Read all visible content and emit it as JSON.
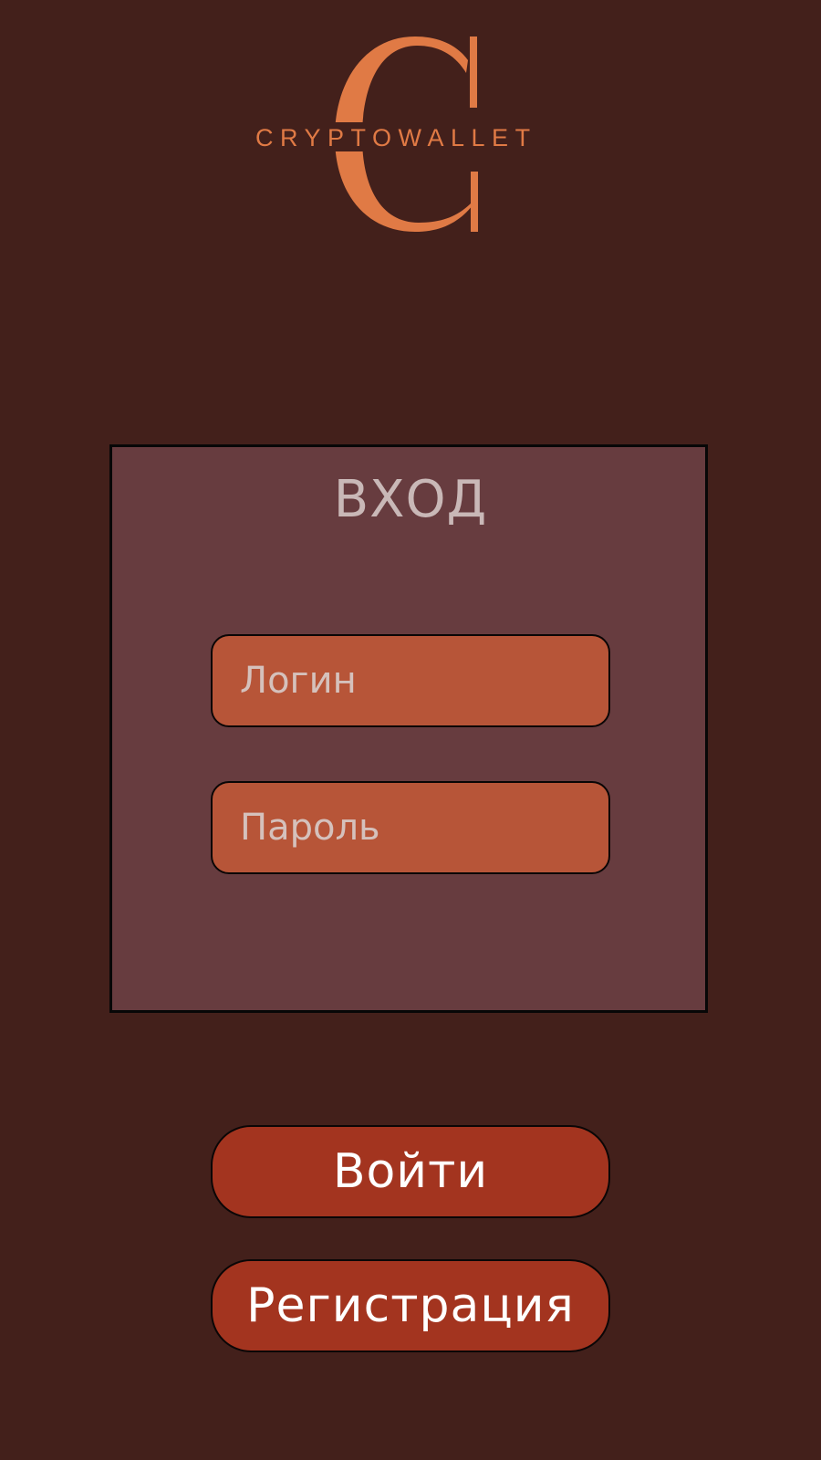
{
  "brand": {
    "name": "CRYPTOWALLET",
    "accent_color": "#e07a45"
  },
  "login_panel": {
    "title": "ВХОД",
    "login_field": {
      "placeholder": "Логин",
      "value": ""
    },
    "password_field": {
      "placeholder": "Пароль",
      "value": ""
    }
  },
  "actions": {
    "login_label": "Войти",
    "register_label": "Регистрация"
  },
  "colors": {
    "background": "#43201b",
    "panel": "#673c3f",
    "field": "#b75538",
    "button": "#a3341f"
  }
}
